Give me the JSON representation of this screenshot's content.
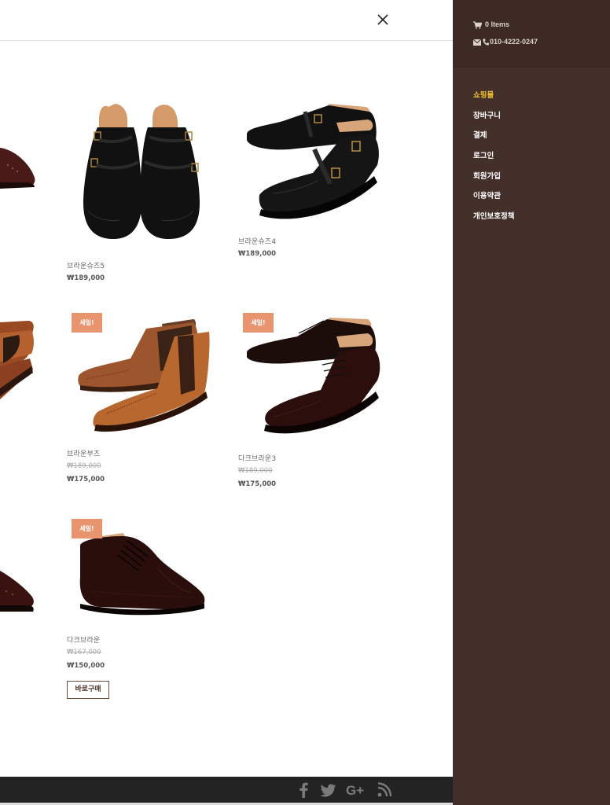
{
  "header": {
    "close_label": "×"
  },
  "products": [
    {
      "name": "브라운슈즈5",
      "price": "₩189,000"
    },
    {
      "name": "브라운슈즈4",
      "price": "₩189,000"
    },
    {
      "name": "브라운부츠",
      "badge": "세일!",
      "old_price": "₩189,000",
      "price": "₩175,000"
    },
    {
      "name": "다크브라운3",
      "badge": "세일!",
      "old_price": "₩189,000",
      "price": "₩175,000"
    },
    {
      "name": "다크브라운",
      "badge": "세일!",
      "old_price": "₩167,000",
      "price": "₩150,000",
      "button": "바로구매"
    }
  ],
  "footer": {
    "social_icons": [
      "facebook-icon",
      "twitter-icon",
      "google-plus-icon",
      "rss-icon"
    ],
    "social_color": "#7a7a7a"
  },
  "sidebar": {
    "cart": "0 Items",
    "phone": "010-4222-0247",
    "menu": [
      "쇼핑몰",
      "장바구니",
      "결제",
      "로그인",
      "회원가입",
      "이용약관",
      "개인보호정책"
    ],
    "active_index": 0,
    "accent_color": "#f2c231",
    "bg_color": "#44302a"
  },
  "colors": {
    "badge": "#e8946e",
    "footer_bg": "#232323"
  }
}
